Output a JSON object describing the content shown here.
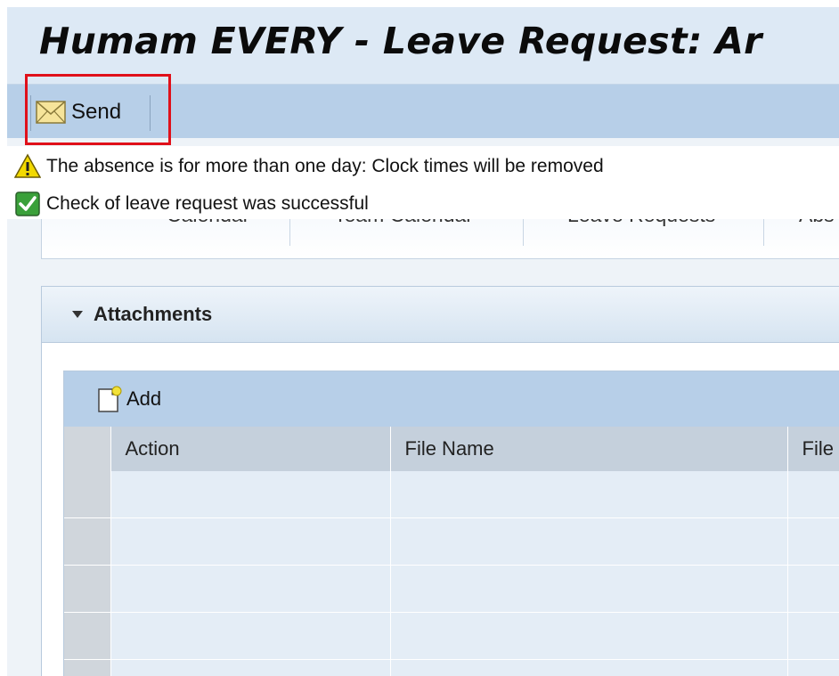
{
  "page": {
    "title": "Humam EVERY - Leave Request: Ar"
  },
  "toolbar": {
    "send_label": "Send",
    "send_icon": "envelope-icon"
  },
  "messages": [
    {
      "type": "warning",
      "icon": "warning-icon",
      "text": "The absence is for more than one day: Clock times will be removed"
    },
    {
      "type": "success",
      "icon": "checkmark-icon",
      "text": "Check of leave request was successful"
    }
  ],
  "tabs": [
    {
      "label": "Calendar"
    },
    {
      "label": "Team Calendar"
    },
    {
      "label": "Leave Requests"
    },
    {
      "label": "Abs"
    }
  ],
  "attachments": {
    "title": "Attachments",
    "add_label": "Add",
    "add_icon": "new-document-icon",
    "columns": [
      "Action",
      "File Name",
      "File"
    ],
    "row_count": 5
  },
  "colors": {
    "toolbar_bg": "#b7cfe8",
    "highlight": "#e0101a",
    "warning": "#f2d900",
    "success": "#3aa03a"
  }
}
